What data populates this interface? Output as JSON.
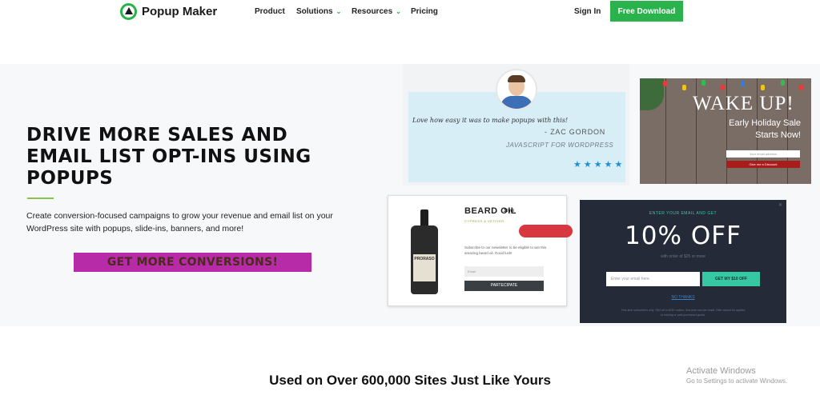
{
  "nav": {
    "brand": "Popup Maker",
    "items": [
      {
        "label": "Product"
      },
      {
        "label": "Solutions"
      },
      {
        "label": "Resources"
      },
      {
        "label": "Pricing"
      }
    ],
    "signin": "Sign In",
    "cta": "Free Download"
  },
  "hero": {
    "headline": "DRIVE MORE SALES AND EMAIL LIST OPT-INS USING POPUPS",
    "subtext": "Create conversion-focused campaigns to grow your revenue and email list on your WordPress site with popups, slide-ins, banners, and more!",
    "cta": "GET MORE CONVERSIONS!"
  },
  "testimonial": {
    "quote": "Love how easy it was to make popups with this!",
    "author": "- ZAC GORDON",
    "role": "JAVASCRIPT FOR WORDPRESS",
    "stars": "★★★★★"
  },
  "wake_popup": {
    "title": "WAKE UP!",
    "line1": "Early Holiday Sale",
    "line2": "Starts Now!",
    "input_placeholder": "Your email address",
    "button": "Give me a Discount"
  },
  "beard_popup": {
    "title": "BEARD OIL",
    "size": "30 ml",
    "tagline": "CYPRESS & VETIVER",
    "text": "Subscribe to our newsletter to be eligible to win this amazing beard oil. Good luck!",
    "input_placeholder": "Email",
    "button": "PARTECIPATE",
    "bottle_label": "PRORASO"
  },
  "discount_popup": {
    "eyebrow": "ENTER YOUR EMAIL AND GET",
    "headline": "10% OFF",
    "sub": "with order of $25 or more",
    "input_placeholder": "Enter your email here",
    "button": "GET MY $10 OFF",
    "decline": "NO THANKS",
    "fine_print": "First-time subscribers only. *$10 off in $25+ orders. One-time use per email. Offer cannot be applied to existing or past purchased goods.",
    "close": "✕"
  },
  "section": {
    "used_on": "Used on Over 600,000 Sites Just Like Yours"
  },
  "watermark": {
    "title": "Activate Windows",
    "sub": "Go to Settings to activate Windows."
  },
  "colors": {
    "brand_green": "#2ab24c",
    "cta_purple": "#b72aa8",
    "accent_line": "#8bc34a"
  }
}
